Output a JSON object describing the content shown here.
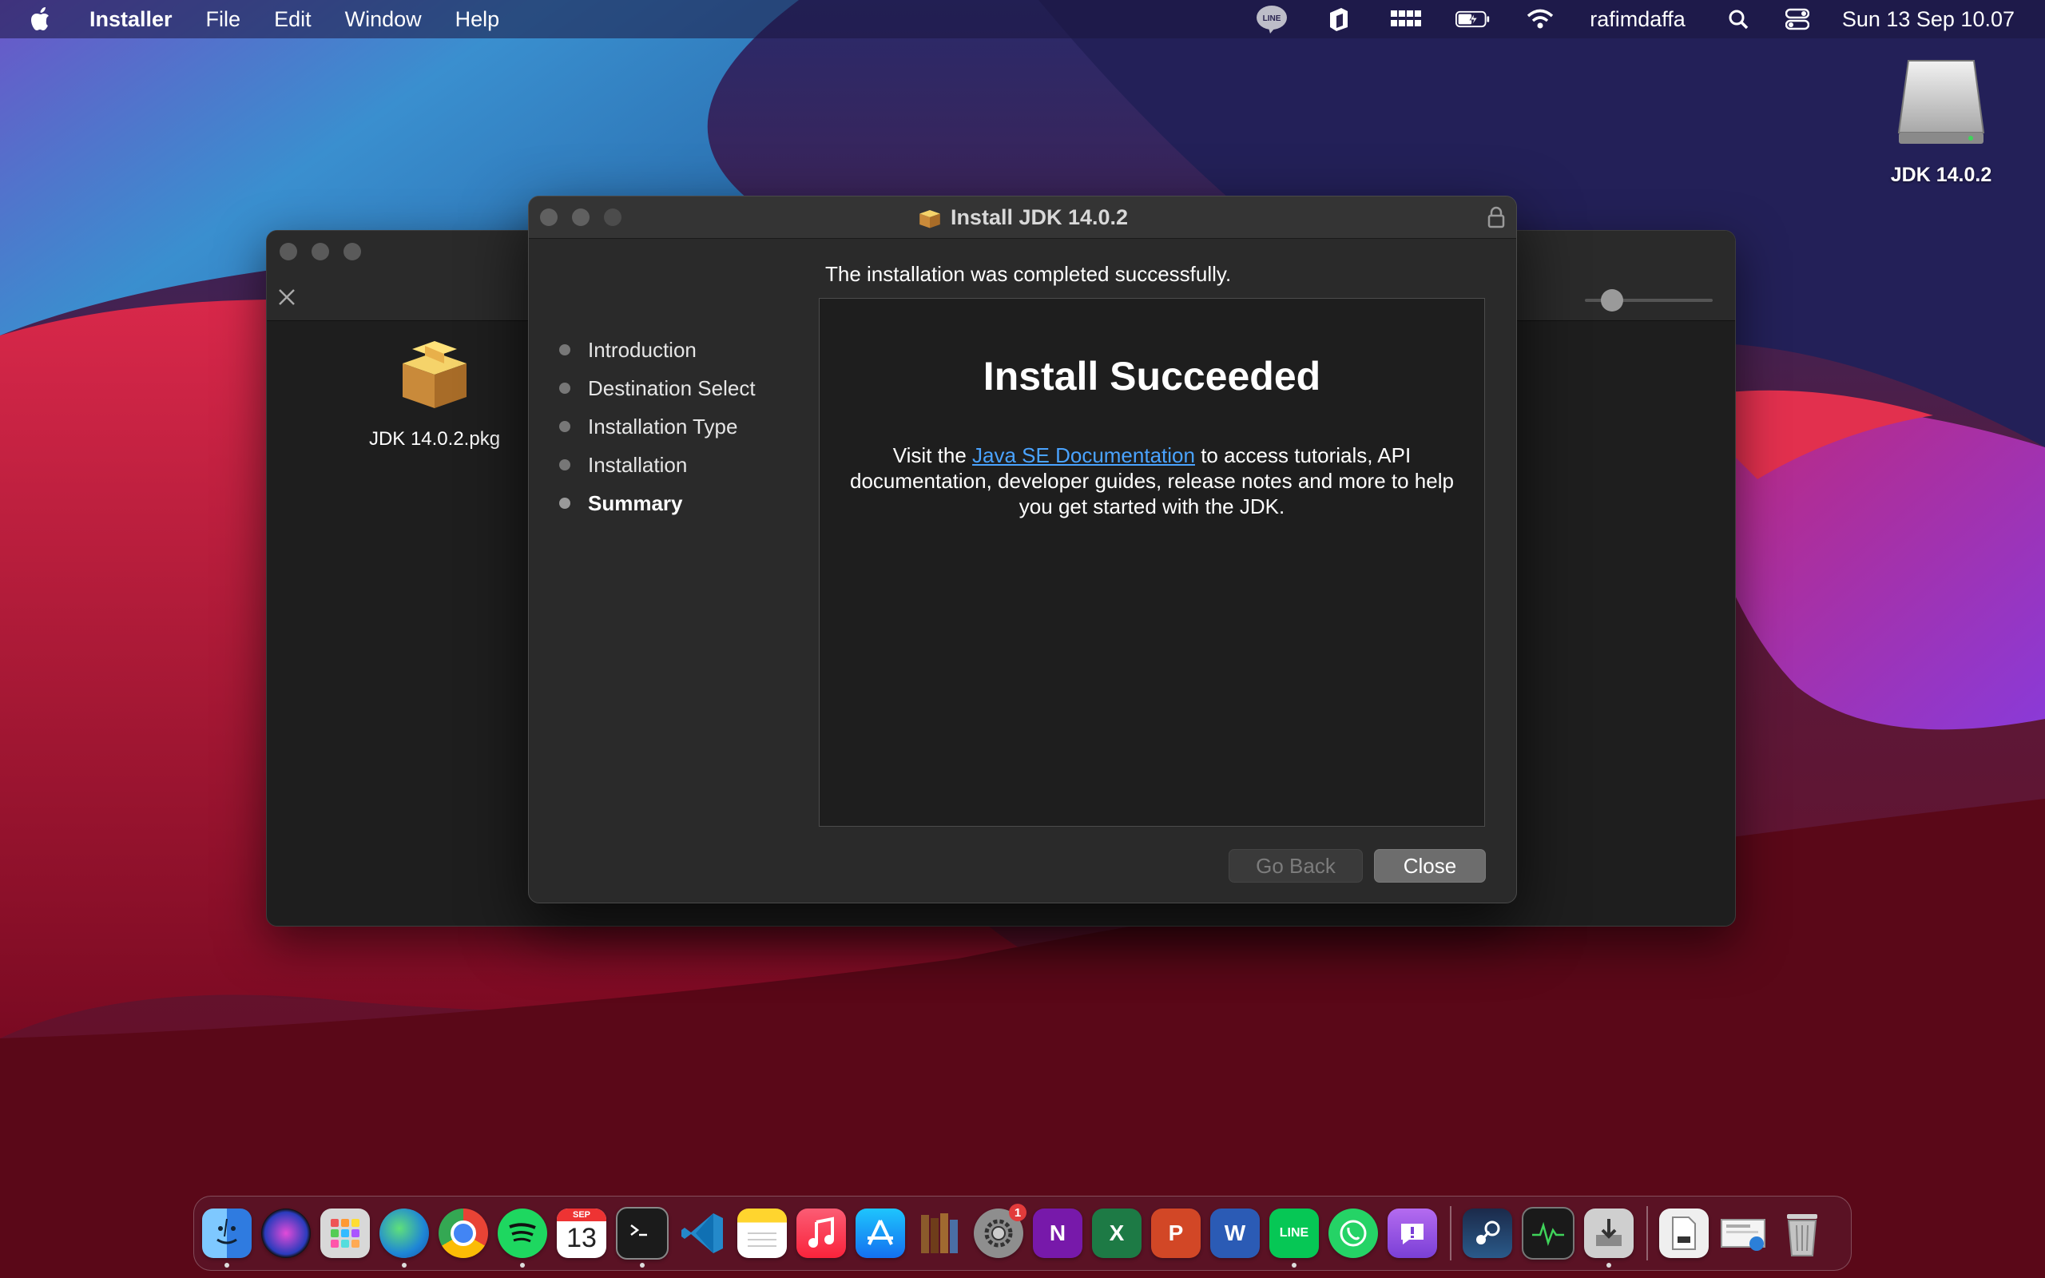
{
  "menubar": {
    "app_name": "Installer",
    "menus": [
      "File",
      "Edit",
      "Window",
      "Help"
    ],
    "status_icons": [
      "line-icon",
      "notion-icon",
      "keyboard-icon",
      "battery-icon",
      "wifi-icon"
    ],
    "username": "rafimdaffa",
    "datetime": "Sun 13 Sep  10.07"
  },
  "desktop": {
    "drive_label": "JDK 14.0.2"
  },
  "finder": {
    "file_label": "JDK 14.0.2.pkg"
  },
  "installer": {
    "title": "Install JDK 14.0.2",
    "status_line": "The installation was completed successfully.",
    "steps": [
      "Introduction",
      "Destination Select",
      "Installation Type",
      "Installation",
      "Summary"
    ],
    "active_step": "Summary",
    "heading": "Install Succeeded",
    "body_prefix": "Visit the ",
    "body_link": "Java SE Documentation",
    "body_suffix": " to access tutorials, API documentation, developer guides, release notes and more to help you get started with the JDK.",
    "go_back_label": "Go Back",
    "close_label": "Close"
  },
  "dock": {
    "calendar_month": "SEP",
    "calendar_day": "13",
    "settings_badge": "1",
    "onenote_letter": "N",
    "excel_letter": "X",
    "powerpoint_letter": "P",
    "word_letter": "W",
    "line_label": "LINE"
  },
  "colors": {
    "link": "#4aa3ff",
    "window_bg": "#2a2a2a",
    "panel_bg": "#1e1e1e"
  }
}
